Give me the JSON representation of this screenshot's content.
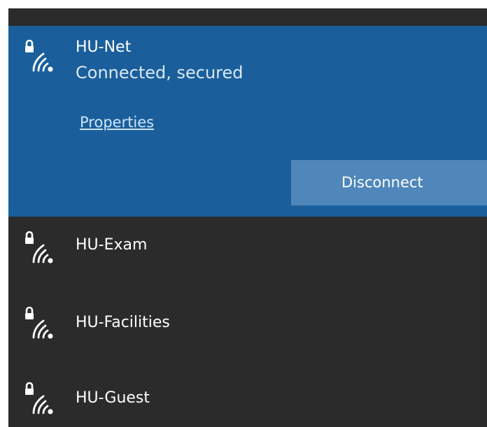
{
  "connected_network": {
    "ssid": "HU-Net",
    "status": "Connected, secured",
    "properties_label": "Properties",
    "disconnect_label": "Disconnect",
    "icon": "wifi-secured-icon"
  },
  "networks": [
    {
      "ssid": "HU-Exam",
      "icon": "wifi-secured-icon"
    },
    {
      "ssid": "HU-Facilities",
      "icon": "wifi-secured-icon"
    },
    {
      "ssid": "HU-Guest",
      "icon": "wifi-secured-icon"
    }
  ],
  "colors": {
    "selected_background": "#1a5f9c",
    "panel_background": "#2b2b2b",
    "button_background": "#4f87ba",
    "text": "#ffffff"
  }
}
